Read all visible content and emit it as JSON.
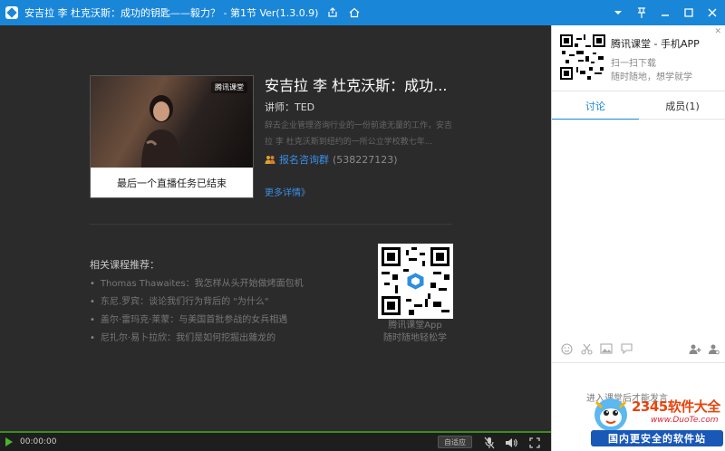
{
  "window": {
    "title": "安吉拉 李 杜克沃斯：成功的钥匙——毅力？ - 第1节 Ver(1.3.0.9)"
  },
  "course": {
    "cover_caption": "最后一个直播任务已结束",
    "cover_badge": "腾讯课堂",
    "title": "安吉拉 李 杜克沃斯：成功...",
    "lecturer": "讲师：TED",
    "description": "辞去企业管理咨询行业的一份前途无量的工作，安吉拉 李 杜克沃斯到纽约的一所公立学校教七年...",
    "group_link": "报名咨询群",
    "group_number": "(538227123)",
    "more_link": "更多详情》"
  },
  "recommendations": {
    "heading": "相关课程推荐：",
    "items": [
      "Thomas Thawaites：我怎样从头开始做烤面包机",
      "东尼.罗宾：谈论我们行为背后的 \"为什么\"",
      "盖尔·雷玛克·莱蒙：与美国首批参战的女兵相遇",
      "尼扎尔·易卜拉欣：我们是如何挖掘出雜龙的"
    ]
  },
  "app_promo_main": {
    "line1": "腾讯课堂App",
    "line2": "随时随地轻松学"
  },
  "player": {
    "time": "00:00:00",
    "adapt_label": "自适应"
  },
  "panel": {
    "app_name": "腾讯课堂 - 手机APP",
    "scan_line1": "扫一扫下载",
    "scan_line2": "随时随地，想学就学",
    "tabs": [
      "讨论",
      "成员(1)"
    ],
    "input_hint": "进入课堂后才能发言"
  },
  "watermark": {
    "brand": "2345软件大全",
    "url": "www.DuoTe.com",
    "slogan": "国内更安全的软件站"
  },
  "colors": {
    "titlebar": "#1a86d8",
    "main_bg": "#2b2b2b",
    "accent_link": "#3a8ee6",
    "progress": "#49b52a"
  }
}
